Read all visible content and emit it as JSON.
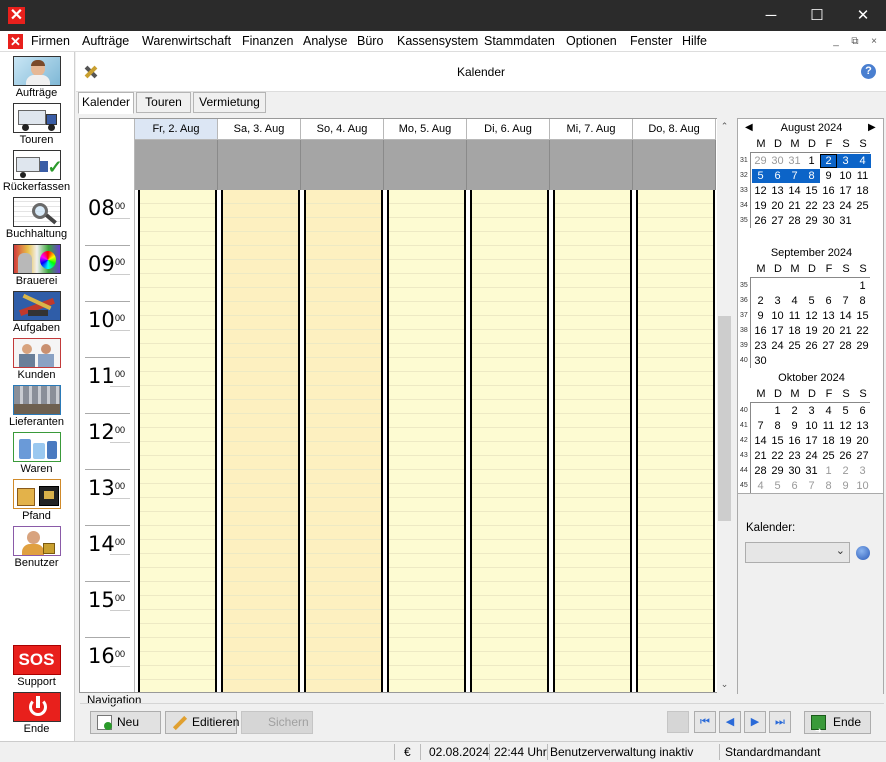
{
  "window": {
    "minimize": "─",
    "maximize": "☐",
    "close": "✕"
  },
  "menu": {
    "items": [
      "Firmen",
      "Aufträge",
      "Warenwirtschaft",
      "Finanzen",
      "Analyse",
      "Büro",
      "Kassensystem",
      "Stammdaten",
      "Optionen",
      "Fenster",
      "Hilfe"
    ],
    "mdi": [
      "_",
      "⧉",
      "×"
    ]
  },
  "sidebar": {
    "items": [
      {
        "label": "Aufträge",
        "icon": "orders-person-icon"
      },
      {
        "label": "Touren",
        "icon": "truck-icon"
      },
      {
        "label": "Rückerfassen",
        "icon": "truck-check-icon"
      },
      {
        "label": "Buchhaltung",
        "icon": "accounting-magnifier-icon"
      },
      {
        "label": "Brauerei",
        "icon": "brewery-icon"
      },
      {
        "label": "Aufgaben",
        "icon": "tools-icon"
      },
      {
        "label": "Kunden",
        "icon": "customers-icon"
      },
      {
        "label": "Lieferanten",
        "icon": "suppliers-icon"
      },
      {
        "label": "Waren",
        "icon": "goods-icon"
      },
      {
        "label": "Pfand",
        "icon": "deposit-crate-icon"
      },
      {
        "label": "Benutzer",
        "icon": "user-lock-icon"
      }
    ],
    "support": {
      "icon_text": "SOS",
      "label": "Support"
    },
    "exit": {
      "label": "Ende"
    }
  },
  "header": {
    "title": "Kalender"
  },
  "tabs": [
    "Kalender",
    "Touren",
    "Vermietung"
  ],
  "calendar": {
    "days": [
      "Fr, 2. Aug",
      "Sa, 3. Aug",
      "So, 4. Aug",
      "Mo, 5. Aug",
      "Di, 6. Aug",
      "Mi, 7. Aug",
      "Do, 8. Aug"
    ],
    "hours": [
      "08",
      "09",
      "10",
      "11",
      "12",
      "13",
      "14",
      "15",
      "16"
    ],
    "minutes": "00"
  },
  "minicals": [
    {
      "title": "August 2024",
      "weekdays": [
        "M",
        "D",
        "M",
        "D",
        "F",
        "S",
        "S"
      ],
      "weeks": [
        {
          "wk": "31",
          "days": [
            "29",
            "30",
            "31",
            "1",
            "2",
            "3",
            "4"
          ]
        },
        {
          "wk": "32",
          "days": [
            "5",
            "6",
            "7",
            "8",
            "9",
            "10",
            "11"
          ]
        },
        {
          "wk": "33",
          "days": [
            "12",
            "13",
            "14",
            "15",
            "16",
            "17",
            "18"
          ]
        },
        {
          "wk": "34",
          "days": [
            "19",
            "20",
            "21",
            "22",
            "23",
            "24",
            "25"
          ]
        },
        {
          "wk": "35",
          "days": [
            "26",
            "27",
            "28",
            "29",
            "30",
            "31",
            ""
          ]
        }
      ]
    },
    {
      "title": "September 2024",
      "weekdays": [
        "M",
        "D",
        "M",
        "D",
        "F",
        "S",
        "S"
      ],
      "weeks": [
        {
          "wk": "35",
          "days": [
            "",
            "",
            "",
            "",
            "",
            "",
            "1"
          ]
        },
        {
          "wk": "36",
          "days": [
            "2",
            "3",
            "4",
            "5",
            "6",
            "7",
            "8"
          ]
        },
        {
          "wk": "37",
          "days": [
            "9",
            "10",
            "11",
            "12",
            "13",
            "14",
            "15"
          ]
        },
        {
          "wk": "38",
          "days": [
            "16",
            "17",
            "18",
            "19",
            "20",
            "21",
            "22"
          ]
        },
        {
          "wk": "39",
          "days": [
            "23",
            "24",
            "25",
            "26",
            "27",
            "28",
            "29"
          ]
        },
        {
          "wk": "40",
          "days": [
            "30",
            "",
            "",
            "",
            "",
            "",
            ""
          ]
        }
      ]
    },
    {
      "title": "Oktober 2024",
      "weekdays": [
        "M",
        "D",
        "M",
        "D",
        "F",
        "S",
        "S"
      ],
      "weeks": [
        {
          "wk": "40",
          "days": [
            "",
            "1",
            "2",
            "3",
            "4",
            "5",
            "6"
          ]
        },
        {
          "wk": "41",
          "days": [
            "7",
            "8",
            "9",
            "10",
            "11",
            "12",
            "13"
          ]
        },
        {
          "wk": "42",
          "days": [
            "14",
            "15",
            "16",
            "17",
            "18",
            "19",
            "20"
          ]
        },
        {
          "wk": "43",
          "days": [
            "21",
            "22",
            "23",
            "24",
            "25",
            "26",
            "27"
          ]
        },
        {
          "wk": "44",
          "days": [
            "28",
            "29",
            "30",
            "31",
            "1",
            "2",
            "3"
          ]
        },
        {
          "wk": "45",
          "days": [
            "4",
            "5",
            "6",
            "7",
            "8",
            "9",
            "10"
          ]
        }
      ]
    }
  ],
  "calendar_select": {
    "label": "Kalender:",
    "value": ""
  },
  "navigation": {
    "label": "Navigation",
    "new": "Neu",
    "edit": "Editieren",
    "save": "Sichern",
    "end": "Ende"
  },
  "status": {
    "currency": "€",
    "date": "02.08.2024",
    "time": "22:44 Uhr",
    "user_mgmt": "Benutzerverwaltung inaktiv",
    "mandant": "Standardmandant"
  },
  "colors": {
    "weekday_bg": "#fdfbd2",
    "weekend_bg": "#fdf0c0",
    "selection": "#0c64c8",
    "allday": "#a5a5a5"
  }
}
